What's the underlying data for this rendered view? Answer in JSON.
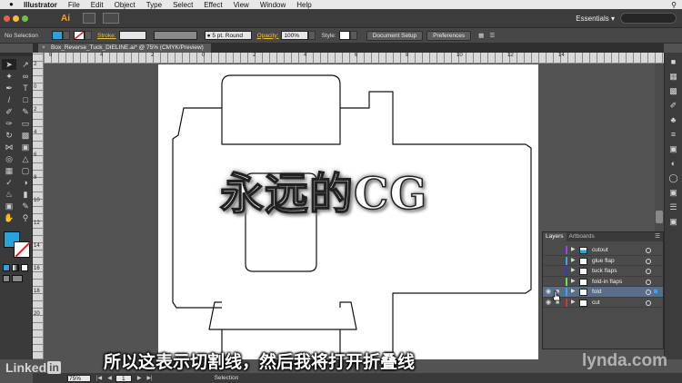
{
  "menubar": {
    "app_name": "Illustrator",
    "items": [
      "File",
      "Edit",
      "Object",
      "Type",
      "Select",
      "Effect",
      "View",
      "Window",
      "Help"
    ],
    "spotlight_icon": "search-icon"
  },
  "appbar": {
    "logo": "Ai",
    "workspace": "Essentials ▾",
    "traffic_colors": [
      "#ee5c50",
      "#f5bd33",
      "#6cc247"
    ]
  },
  "control_bar": {
    "selection_label": "No Selection",
    "fill_color": "#29a3dc",
    "stroke_label": "Stroke:",
    "brush_value": "5 pt. Round",
    "opacity_label": "Opacity:",
    "opacity_value": "100%",
    "style_label": "Style:",
    "document_setup": "Document Setup",
    "preferences": "Preferences"
  },
  "document": {
    "tab_title": "Box_Reverse_Tuck_DIELINE.ai* @ 75% (CMYK/Preview)",
    "close_icon": "close-icon"
  },
  "rulers": {
    "h_numbers": [
      "6",
      "4",
      "2",
      "0",
      "2",
      "4",
      "6",
      "8",
      "10",
      "12",
      "14"
    ],
    "v_numbers": [
      "2",
      "0",
      "2",
      "4",
      "6",
      "8",
      "10",
      "12",
      "14",
      "16",
      "18",
      "20"
    ]
  },
  "layers_panel": {
    "tabs": [
      "Layers",
      "Artboards"
    ],
    "menu_icon": "panel-menu-icon",
    "layers": [
      {
        "name": "cutout",
        "color": "#a040ff",
        "eye": false,
        "lock": false,
        "selected": false,
        "has_thumb_art": true
      },
      {
        "name": "glue flap",
        "color": "#3aa0ff",
        "eye": false,
        "lock": false,
        "selected": false,
        "has_thumb_art": false
      },
      {
        "name": "tuck flaps",
        "color": "#3838c8",
        "eye": false,
        "lock": false,
        "selected": false,
        "has_thumb_art": false
      },
      {
        "name": "fold-in flaps",
        "color": "#6fe05a",
        "eye": false,
        "lock": false,
        "selected": false,
        "has_thumb_art": false
      },
      {
        "name": "fold",
        "color": "#3aa0ff",
        "eye": true,
        "lock": true,
        "selected": true,
        "has_thumb_art": false
      },
      {
        "name": "cut",
        "color": "#e03030",
        "eye": true,
        "lock": true,
        "selected": false,
        "has_thumb_art": false
      }
    ]
  },
  "status_bar": {
    "zoom": "75%",
    "page": "1",
    "mode": "Selection"
  },
  "overlays": {
    "watermark": "永远的CG",
    "subtitle": "所以这表示切割线，然后我将打开折叠线",
    "lynda": "lynda.com",
    "linkedin": "Linked",
    "linkedin_in": "in"
  }
}
